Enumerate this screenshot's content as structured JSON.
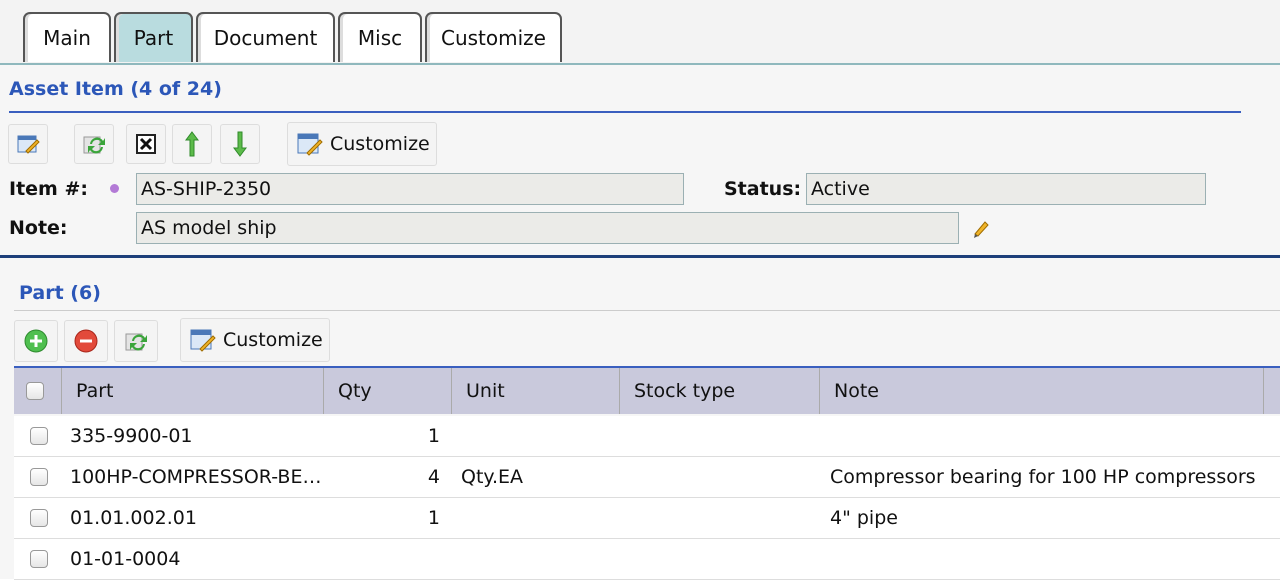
{
  "tabs": [
    {
      "label": "Main"
    },
    {
      "label": "Part"
    },
    {
      "label": "Document"
    },
    {
      "label": "Misc"
    },
    {
      "label": "Customize"
    }
  ],
  "asset": {
    "title": "Asset Item (4 of 24)",
    "customize_label": "Customize",
    "item_label": "Item #:",
    "item_value": "AS-SHIP-2350",
    "status_label": "Status:",
    "status_value": "Active",
    "note_label": "Note:",
    "note_value": "AS model ship"
  },
  "parts": {
    "title": "Part (6)",
    "customize_label": "Customize",
    "columns": [
      "Part",
      "Qty",
      "Unit",
      "Stock type",
      "Note"
    ],
    "rows": [
      {
        "part": "335-9900-01",
        "qty": "1",
        "unit": "",
        "stock": "",
        "note": ""
      },
      {
        "part": "100HP-COMPRESSOR-BE…",
        "qty": "4",
        "unit": "Qty.EA",
        "stock": "",
        "note": "Compressor bearing for 100 HP compressors"
      },
      {
        "part": "01.01.002.01",
        "qty": "1",
        "unit": "",
        "stock": "",
        "note": "4\" pipe"
      },
      {
        "part": "01-01-0004",
        "qty": "",
        "unit": "",
        "stock": "",
        "note": ""
      }
    ]
  },
  "colors": {
    "accent": "#2c57b8",
    "active_tab": "#b9dcdf",
    "grid_header": "#c9c9dc"
  }
}
